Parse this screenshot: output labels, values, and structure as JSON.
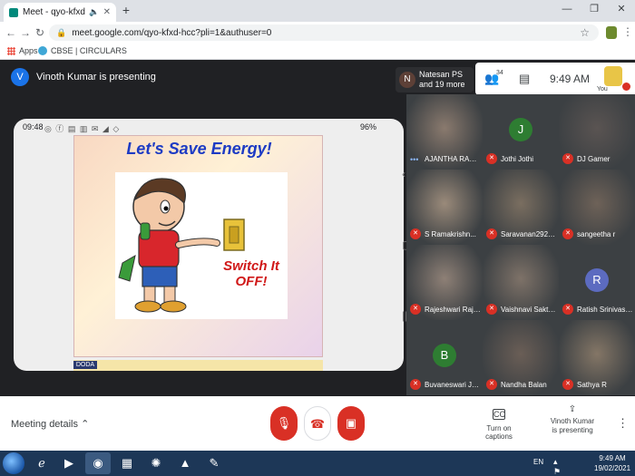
{
  "browser": {
    "tab_title": "Meet - qyo-kfxd-hcc",
    "url": "meet.google.com/qyo-kfxd-hcc?pli=1&authuser=0",
    "bookmarks": [
      "Apps",
      "CBSE | CIRCULARS"
    ]
  },
  "meet": {
    "presenter_initial": "V",
    "presenter_text": "Vinoth Kumar is presenting",
    "people_chip": {
      "initial": "N",
      "line1": "Natesan PS",
      "line2": "and 19 more"
    },
    "people_count": "34",
    "time": "9:49 AM",
    "you_label": "You",
    "shared_screen": {
      "status_time": "09:48",
      "battery": "96%",
      "slide_title": "Let's Save Energy!",
      "slide_text_line1": "Switch It",
      "slide_text_line2": "OFF!",
      "strip_tag": "DODA"
    },
    "participants": [
      {
        "name": "AJANTHA RAM...",
        "initial": "",
        "video": true,
        "muted": false
      },
      {
        "name": "Jothi Jothi",
        "initial": "J",
        "color": "#2e7d32",
        "muted": true
      },
      {
        "name": "DJ Gamer",
        "initial": "",
        "video": true,
        "muted": true
      },
      {
        "name": "S Ramakrishn...",
        "initial": "",
        "video": true,
        "muted": true
      },
      {
        "name": "Saravanan2929 ...",
        "initial": "",
        "video": true,
        "muted": true
      },
      {
        "name": "sangeetha r",
        "initial": "",
        "video": true,
        "muted": true
      },
      {
        "name": "Rajeshwari Raja...",
        "initial": "",
        "video": true,
        "muted": true
      },
      {
        "name": "Vaishnavi Sakthi ...",
        "initial": "",
        "video": true,
        "muted": true
      },
      {
        "name": "Ratish Srinivasan",
        "initial": "R",
        "color": "#5c6bc0",
        "muted": true
      },
      {
        "name": "Buvaneswari Jay...",
        "initial": "B",
        "color": "#2e7d32",
        "muted": true
      },
      {
        "name": "Nandha Balan",
        "initial": "",
        "video": true,
        "muted": true
      },
      {
        "name": "Sathya R",
        "initial": "",
        "video": true,
        "muted": true
      }
    ]
  },
  "controls": {
    "meeting_details": "Meeting details",
    "captions": "Turn on captions",
    "captions_icon": "CC",
    "presenting_line1": "Vinoth Kumar",
    "presenting_line2": "is presenting"
  },
  "taskbar": {
    "lang": "EN",
    "time": "9:49 AM",
    "date": "19/02/2021"
  }
}
